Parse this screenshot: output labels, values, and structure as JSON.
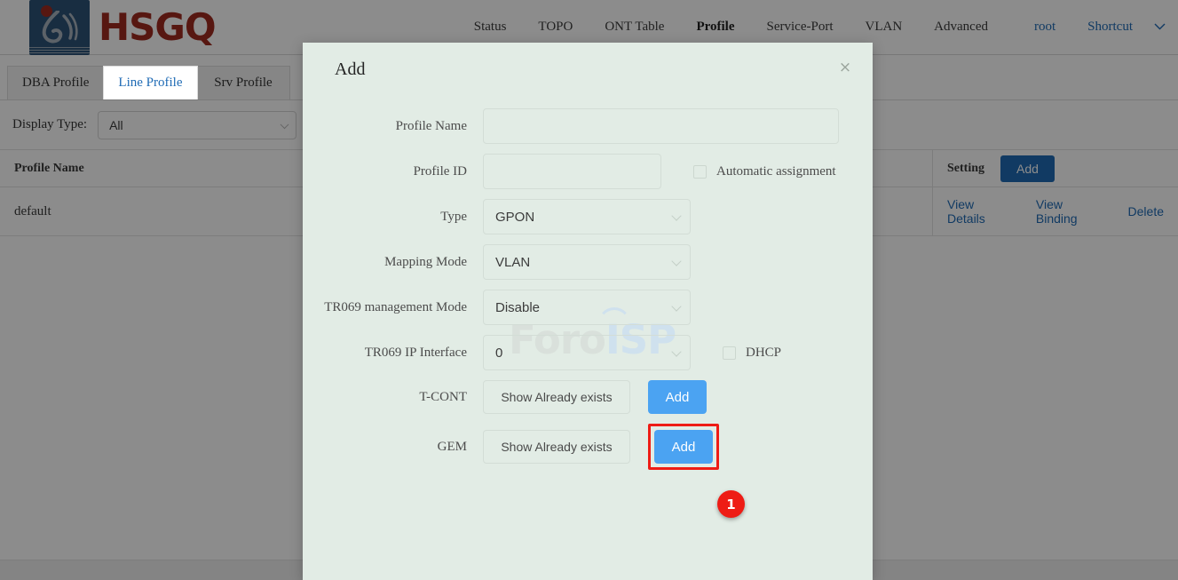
{
  "brand": {
    "name": "HSGQ",
    "logo_alt": "hsgq-logo"
  },
  "nav": {
    "items": [
      {
        "label": "Status",
        "active": false
      },
      {
        "label": "TOPO",
        "active": false
      },
      {
        "label": "ONT Table",
        "active": false
      },
      {
        "label": "Profile",
        "active": true
      },
      {
        "label": "Service-Port",
        "active": false
      },
      {
        "label": "VLAN",
        "active": false
      },
      {
        "label": "Advanced",
        "active": false
      }
    ],
    "user": "root",
    "shortcut": "Shortcut",
    "chevron": "⌄"
  },
  "tabs": [
    {
      "label": "DBA Profile",
      "active": false
    },
    {
      "label": "Line Profile",
      "active": true
    },
    {
      "label": "Srv Profile",
      "active": false
    }
  ],
  "filter": {
    "label": "Display Type:",
    "value": "All"
  },
  "table": {
    "headers": {
      "profile_name": "Profile Name",
      "setting": "Setting"
    },
    "header_add_button": "Add",
    "rows": [
      {
        "profile_name": "default",
        "actions": [
          "View Details",
          "View Binding",
          "Delete"
        ]
      }
    ]
  },
  "modal": {
    "title": "Add",
    "close_icon": "×",
    "watermark": {
      "part1": "Foro",
      "part2": "ISP"
    },
    "fields": {
      "profile_name": {
        "label": "Profile Name",
        "value": "",
        "placeholder": ""
      },
      "profile_id": {
        "label": "Profile ID",
        "value": "",
        "placeholder": ""
      },
      "automatic_assignment": {
        "label": "Automatic assignment",
        "checked": false
      },
      "type": {
        "label": "Type",
        "value": "GPON"
      },
      "mapping_mode": {
        "label": "Mapping Mode",
        "value": "VLAN"
      },
      "tr069_management_mode": {
        "label": "TR069 management Mode",
        "value": "Disable"
      },
      "tr069_ip_interface": {
        "label": "TR069 IP Interface",
        "value": "0"
      },
      "dhcp": {
        "label": "DHCP",
        "checked": false
      },
      "tcont": {
        "label": "T-CONT",
        "show_button": "Show Already exists",
        "add_button": "Add"
      },
      "gem": {
        "label": "GEM",
        "show_button": "Show Already exists",
        "add_button": "Add"
      }
    }
  },
  "annotation": {
    "step_number": "1",
    "accent_color": "#ee1c15"
  },
  "colors": {
    "brand_red": "#9e2b20",
    "link_blue": "#1f6bb5",
    "button_blue": "#4ba3f2",
    "modal_bg": "#e2ece5"
  }
}
